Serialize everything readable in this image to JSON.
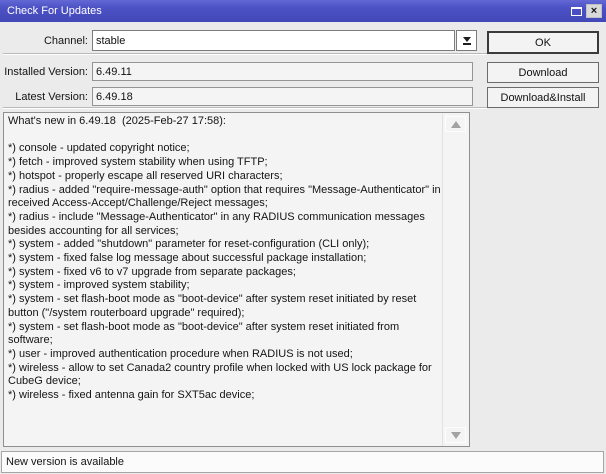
{
  "window": {
    "title": "Check For Updates"
  },
  "icons": {
    "window_maximize": "outlined-square",
    "window_close": "×",
    "channel_dropdown": "down-arrow-to-bar",
    "scroll_up": "up-triangle",
    "scroll_down": "down-triangle"
  },
  "form": {
    "channel": {
      "label": "Channel:",
      "value": "stable"
    },
    "installed_version": {
      "label": "Installed Version:",
      "value": "6.49.11"
    },
    "latest_version": {
      "label": "Latest Version:",
      "value": "6.49.18"
    }
  },
  "buttons": {
    "ok": "OK",
    "download": "Download",
    "download_install": "Download&Install"
  },
  "changelog": {
    "lines": [
      "What's new in 6.49.18  (2025-Feb-27 17:58):",
      "",
      "*) console - updated copyright notice;",
      "*) fetch - improved system stability when using TFTP;",
      "*) hotspot - properly escape all reserved URI characters;",
      "*) radius - added \"require-message-auth\" option that requires \"Message-Authenticator\" in received Access-Accept/Challenge/Reject messages;",
      "*) radius - include \"Message-Authenticator\" in any RADIUS communication messages besides accounting for all services;",
      "*) system - added \"shutdown\" parameter for reset-configuration (CLI only);",
      "*) system - fixed false log message about successful package installation;",
      "*) system - fixed v6 to v7 upgrade from separate packages;",
      "*) system - improved system stability;",
      "*) system - set flash-boot mode as \"boot-device\" after system reset initiated by reset button (\"/system routerboard upgrade\" required);",
      "*) system - set flash-boot mode as \"boot-device\" after system reset initiated from software;",
      "*) user - improved authentication procedure when RADIUS is not used;",
      "*) wireless - allow to set Canada2 country profile when locked with US lock package for CubeG device;",
      "*) wireless - fixed antenna gain for SXT5ac device;"
    ]
  },
  "status_bar": {
    "text": "New version is available"
  },
  "colors": {
    "titlebar": "#4c51c4",
    "titlebar_text": "#ffffff",
    "dialog_bg": "#ebebeb",
    "field_readonly_bg": "#f4f4f4",
    "changelog_bg": "#f4f4f4"
  }
}
